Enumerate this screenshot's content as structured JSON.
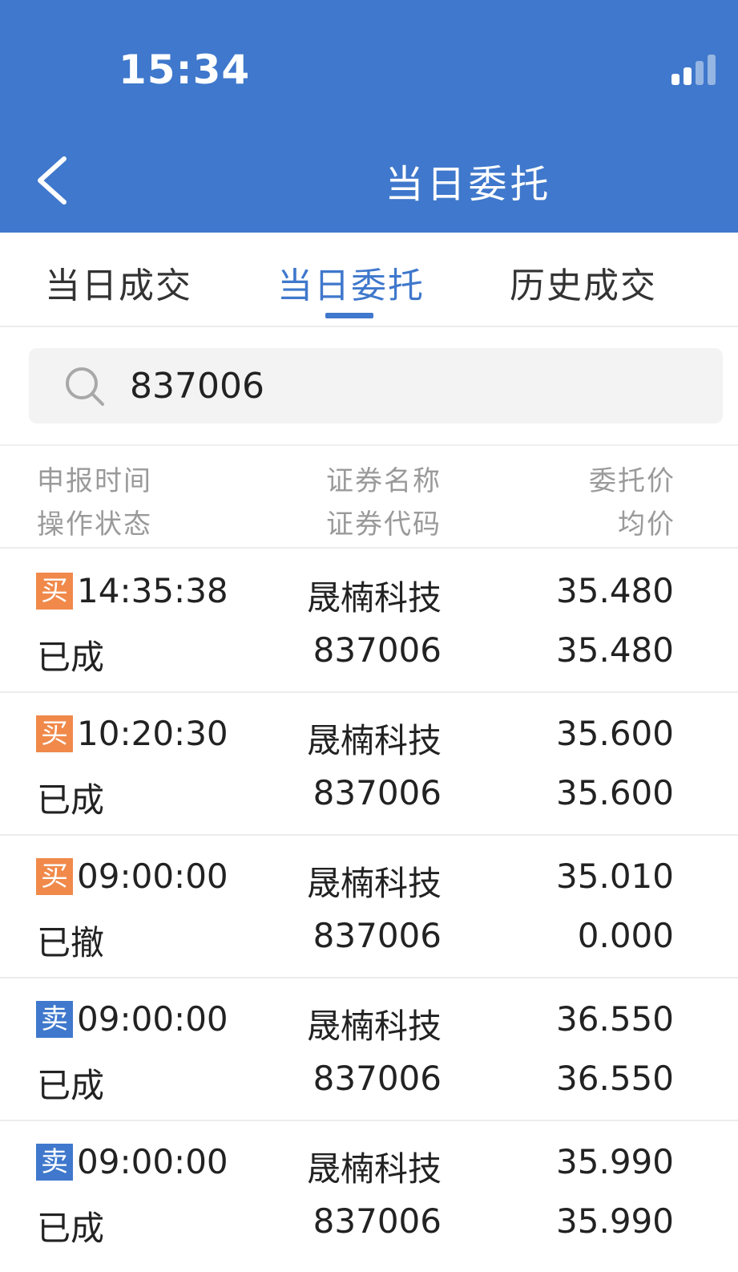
{
  "status_bar": {
    "time": "15:34",
    "signal_icon": "signal-bars-icon"
  },
  "nav": {
    "title": "当日委托",
    "back_icon": "chevron-left-icon"
  },
  "tabs": [
    {
      "label": "当日成交",
      "active": false
    },
    {
      "label": "当日委托",
      "active": true
    },
    {
      "label": "历史成交",
      "active": false
    }
  ],
  "search": {
    "value": "837006",
    "icon": "search-icon"
  },
  "columns": {
    "col1_line1": "申报时间",
    "col1_line2": "操作状态",
    "col2_line1": "证券名称",
    "col2_line2": "证券代码",
    "col3_line1": "委托价",
    "col3_line2": "均价"
  },
  "colors": {
    "primary": "#3f78cc",
    "buy": "#f0894a",
    "sell": "#3f78cc"
  },
  "orders": [
    {
      "side": "买",
      "side_type": "buy",
      "time": "14:35:38",
      "status": "已成",
      "name": "晟楠科技",
      "code": "837006",
      "price": "35.480",
      "avg": "35.480"
    },
    {
      "side": "买",
      "side_type": "buy",
      "time": "10:20:30",
      "status": "已成",
      "name": "晟楠科技",
      "code": "837006",
      "price": "35.600",
      "avg": "35.600"
    },
    {
      "side": "买",
      "side_type": "buy",
      "time": "09:00:00",
      "status": "已撤",
      "name": "晟楠科技",
      "code": "837006",
      "price": "35.010",
      "avg": "0.000"
    },
    {
      "side": "卖",
      "side_type": "sell",
      "time": "09:00:00",
      "status": "已成",
      "name": "晟楠科技",
      "code": "837006",
      "price": "36.550",
      "avg": "36.550"
    },
    {
      "side": "卖",
      "side_type": "sell",
      "time": "09:00:00",
      "status": "已成",
      "name": "晟楠科技",
      "code": "837006",
      "price": "35.990",
      "avg": "35.990"
    }
  ]
}
